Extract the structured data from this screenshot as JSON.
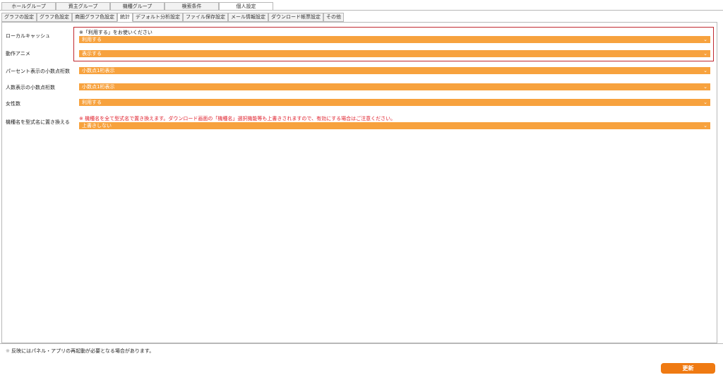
{
  "top_tabs": [
    {
      "label": "ホールグループ"
    },
    {
      "label": "資主グループ"
    },
    {
      "label": "機種グループ"
    },
    {
      "label": "検索条件"
    },
    {
      "label": "個人設定"
    }
  ],
  "active_top_tab": "個人設定",
  "sub_tabs": [
    {
      "label": "グラフの設定"
    },
    {
      "label": "グラフ色設定"
    },
    {
      "label": "商圏グラフ色設定"
    },
    {
      "label": "統計"
    },
    {
      "label": "デフォルト分析設定"
    },
    {
      "label": "ファイル保存設定"
    },
    {
      "label": "メール情報設定"
    },
    {
      "label": "ダウンロード帳票設定"
    },
    {
      "label": "その他"
    }
  ],
  "active_sub_tab": "統計",
  "settings": {
    "local_cache": {
      "label": "ローカルキャッシュ",
      "note": "※「利用する」をお使いください",
      "value": "利用する"
    },
    "animation": {
      "label": "動作アニメ",
      "value": "表示する"
    },
    "percent_decimals": {
      "label": "パーセント表示の小数点桁数",
      "value": "小数点1桁表示"
    },
    "people_decimals": {
      "label": "人数表示の小数点桁数",
      "value": "小数点1桁表示"
    },
    "female_count": {
      "label": "女性数",
      "value": "利用する"
    },
    "replace_model_name": {
      "label": "機種名を型式名に置き換える",
      "note": "※ 機種名を全て型式名で置き換えます。ダウンロード画面の「機種名」選択機能等も上書きされますので、有効にする場合はご注意ください。",
      "value": "上書きしない"
    }
  },
  "footer": {
    "mark": "※",
    "note": "反映にはパネル・アプリの再起動が必要となる場合があります。"
  },
  "update_button": {
    "label": "更新"
  },
  "colors": {
    "accent": "#f7a23e",
    "button": "#ef7a12",
    "warning": "#e0202c",
    "highlight_border": "#c0282f"
  },
  "icons": {
    "select_arrow": "chevron-down-icon"
  }
}
